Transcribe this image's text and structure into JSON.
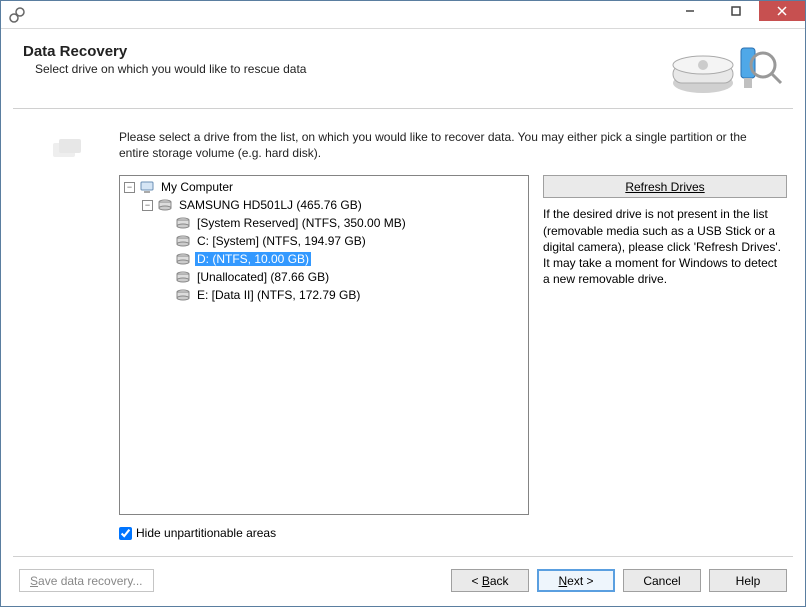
{
  "header": {
    "title": "Data Recovery",
    "subtitle": "Select drive on which you would like to rescue data"
  },
  "instruction": "Please select a drive from the list, on which you would like to recover data. You may either pick a single partition or the entire storage volume (e.g. hard disk).",
  "tree": {
    "root_label": "My Computer",
    "disk_label": "SAMSUNG HD501LJ (465.76 GB)",
    "partitions": [
      "[System Reserved] (NTFS, 350.00 MB)",
      "C: [System] (NTFS, 194.97 GB)",
      "D: (NTFS, 10.00 GB)",
      "[Unallocated] (87.66 GB)",
      "E: [Data II] (NTFS, 172.79 GB)"
    ],
    "selected_index": 2
  },
  "side": {
    "refresh_label": "Refresh Drives",
    "note": "If the desired drive is not present in the list (removable media such as a USB Stick or a digital camera), please click 'Refresh Drives'. It may take a moment for Windows to detect a new removable drive."
  },
  "checkbox": {
    "label": "Hide unpartitionable areas",
    "checked": true
  },
  "footer": {
    "save_label": "Save data recovery...",
    "back_prefix": "< ",
    "back_accel": "B",
    "back_rest": "ack",
    "next_accel": "N",
    "next_rest": "ext >",
    "cancel_label": "Cancel",
    "help_label": "Help"
  }
}
